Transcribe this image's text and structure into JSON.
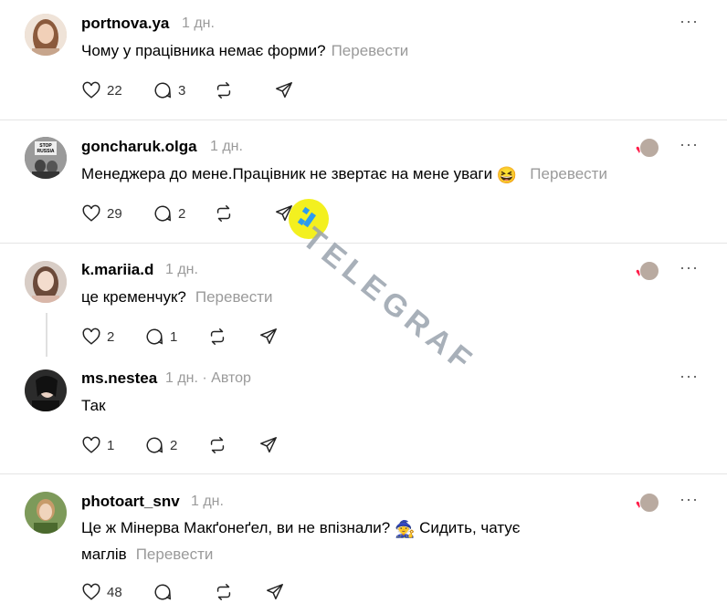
{
  "posts": [
    {
      "username": "portnova.ya",
      "meta": "1 дн.",
      "text": "Чому у працівника немає форми?",
      "translate": "Перевести",
      "likes": "22",
      "replies": "3"
    },
    {
      "username": "goncharuk.olga",
      "meta": "1 дн.",
      "text": "Менеджера до мене.Працівник не звертає на мене уваги",
      "emoji": "😆",
      "translate": "Перевести",
      "likes": "29",
      "replies": "2",
      "avatar_label_top": "STOP",
      "avatar_label_bottom": "RUSSIA"
    },
    {
      "username": "k.mariia.d",
      "meta": "1 дн.",
      "text": "це кременчук?",
      "translate": "Перевести",
      "likes": "2",
      "replies": "1"
    },
    {
      "username": "ms.nestea",
      "meta": "1 дн. · Автор",
      "text": "Так",
      "likes": "1",
      "replies": "2"
    },
    {
      "username": "photoart_snv",
      "meta": "1 дн.",
      "text_line1": "Це ж Мінерва Макґонеґел, ви не впізнали?",
      "emoji": "🧙",
      "text_line1_end": "Сидить, чатує",
      "text_line2": "маглів",
      "translate": "Перевести",
      "likes": "48"
    }
  ],
  "more_label": "···",
  "watermark": "TELEGRAF",
  "colors": {
    "like_heart": "#ff1f4b",
    "muted": "#9a9a9a",
    "watermark_badge": "#f3f01f"
  }
}
